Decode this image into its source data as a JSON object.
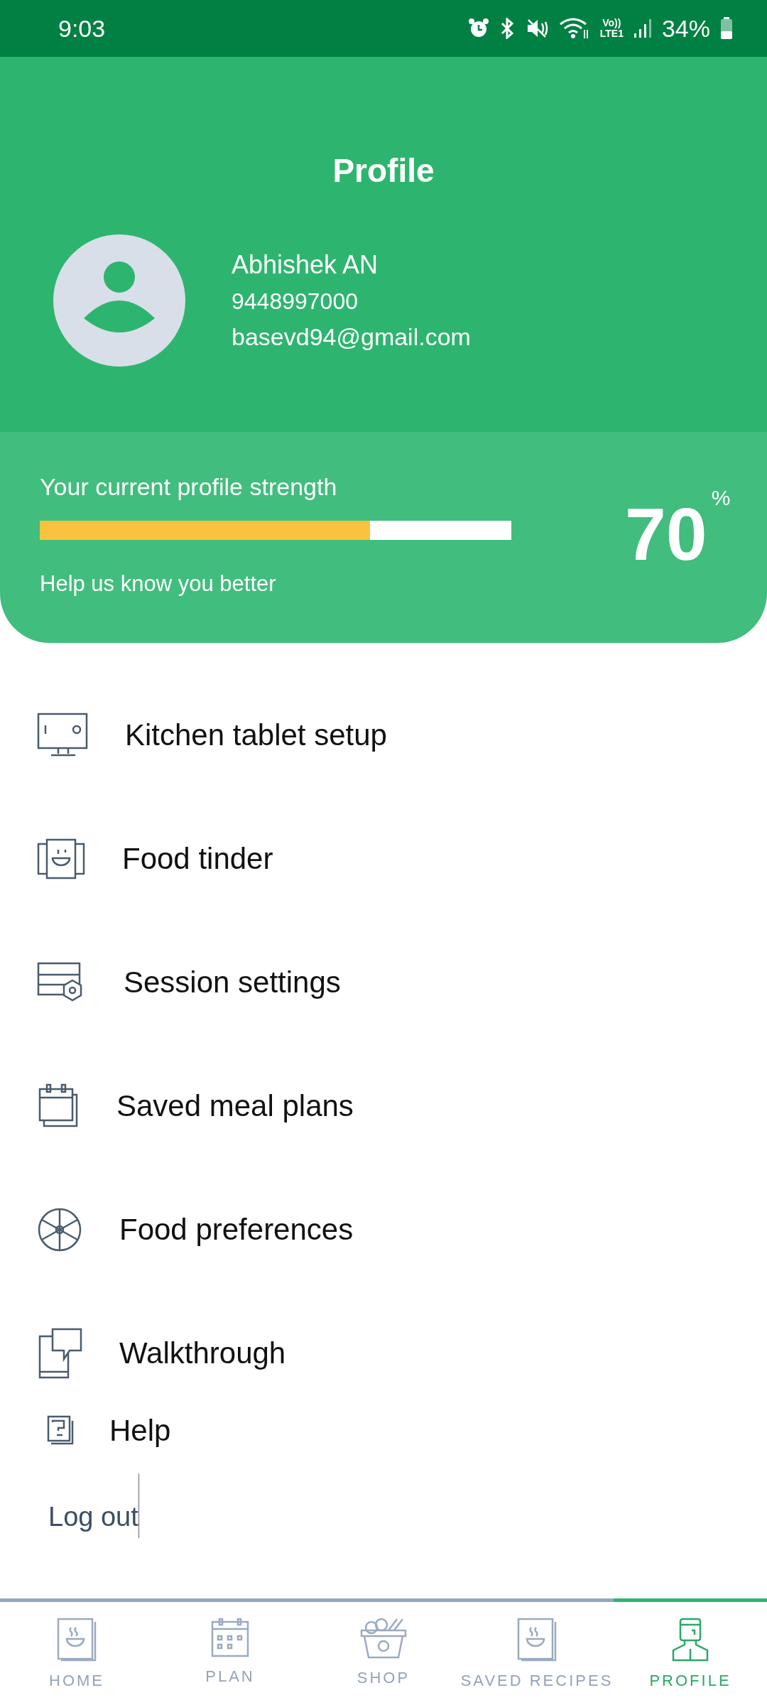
{
  "status_bar": {
    "time": "9:03",
    "network_top": "Vo))",
    "network_bottom": "LTE1",
    "battery": "34%"
  },
  "header": {
    "title": "Profile",
    "name": "Abhishek AN",
    "phone": "9448997000",
    "email": "basevd94@gmail.com"
  },
  "strength": {
    "label": "Your current profile strength",
    "level": 0.7,
    "hint": "Help us know you better",
    "value": "70",
    "unit": "%"
  },
  "menu": [
    {
      "kind": "tablet",
      "label": "Kitchen tablet setup"
    },
    {
      "kind": "tinder",
      "label": "Food tinder"
    },
    {
      "kind": "settings",
      "label": "Session settings"
    },
    {
      "kind": "calendar",
      "label": "Saved meal plans"
    },
    {
      "kind": "wheel",
      "label": "Food preferences"
    },
    {
      "kind": "walkthrough",
      "label": "Walkthrough"
    },
    {
      "kind": "help",
      "label": "Help"
    }
  ],
  "logout": "Log out",
  "tabs": [
    {
      "kind": "home",
      "label": "HOME",
      "selected": false
    },
    {
      "kind": "plan",
      "label": "PLAN",
      "selected": false
    },
    {
      "kind": "shop",
      "label": "SHOP",
      "selected": false
    },
    {
      "kind": "saved",
      "label": "SAVED RECIPES",
      "selected": false
    },
    {
      "kind": "profile",
      "label": "PROFILE",
      "selected": true
    }
  ]
}
